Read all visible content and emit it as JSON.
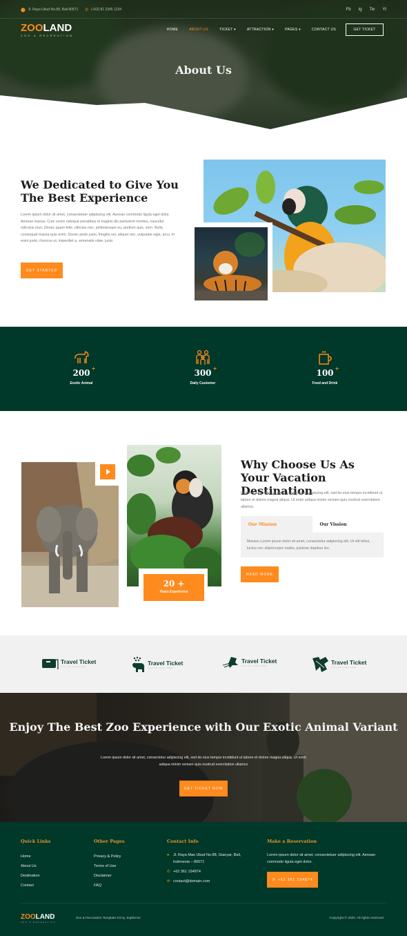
{
  "topbar": {
    "address": "Jl. Raya Ubud No.88, Bali 80571",
    "phone": "(+62) 81 2345 1234",
    "social": [
      "Fb",
      "Ig",
      "Tw",
      "Yt"
    ]
  },
  "brand": {
    "name_part1": "Z",
    "name_o": "OO",
    "name_part2": "LAND",
    "tagline": "ZOO & RECREATION"
  },
  "nav": {
    "items": [
      {
        "label": "HOME",
        "active": false
      },
      {
        "label": "ABOUT US",
        "active": true
      },
      {
        "label": "TICKET",
        "dropdown": true
      },
      {
        "label": "ATTRACTION",
        "dropdown": true
      },
      {
        "label": "PAGES",
        "dropdown": true
      },
      {
        "label": "CONTACT US",
        "active": false
      }
    ],
    "cta": "GET TICKET"
  },
  "hero": {
    "title": "About Us"
  },
  "about": {
    "title": "We Dedicated to Give You The Best Experience",
    "text": "Lorem ipsum dolor sit amet, consectetuer adipiscing elit. Aenean commodo ligula eget dolor. Aenean massa. Cum sociis natoque penatibus et magnis dis parturient montes, nascetur ridiculus mus. Donec quam felis, ultricies nec, pellentesque eu, pretium quis, sem. Nulla consequat massa quis enim. Donec pede justo, fringilla vel, aliquet nec, vulputate eget, arcu. In enim justo, rhoncus ut, imperdiet a, venenatis vitae, justo.",
    "button": "GET STARTED"
  },
  "stats": [
    {
      "icon": "horse-icon",
      "value": "200",
      "suffix": "+",
      "label": "Exotic Animal"
    },
    {
      "icon": "family-icon",
      "value": "300",
      "suffix": "+",
      "label": "Daily Customer"
    },
    {
      "icon": "cup-icon",
      "value": "100",
      "suffix": "+",
      "label": "Food and Drink"
    }
  ],
  "why": {
    "title": "Why Choose Us As Your Vacation Destination",
    "text": "Lorem ipsum dolor sit amet, consectetur adipiscing elit, sed do eius tempor incididunt ut labore et dolore magna aliqua. Ut enim adiqua minim veniam quis nostrud exercitation ullamco.",
    "tabs": [
      "Our Mission",
      "Our Vission"
    ],
    "active_tab": "Our Mission",
    "panel_text": "Mission Lorem ipsum dolor sit amet, consectetur adipiscing elit. Ut elit tellus, luctus nec ullamcorper mattis, pulvinar dapibus leo.",
    "button": "READ MORE",
    "experience_value": "20 +",
    "experience_label": "Years Experience"
  },
  "partners": [
    {
      "name": "Travel Ticket",
      "tagline": "TAGLINE GOES HERE"
    },
    {
      "name": "Travel Ticket",
      "tagline": "TAGLINE GOES HERE"
    },
    {
      "name": "Travel Ticket",
      "tagline": "TAGLINE GOES HERE"
    },
    {
      "name": "Travel Ticket",
      "tagline": "TAGLINE GOES HERE"
    }
  ],
  "cta": {
    "title": "Enjoy The Best Zoo Experience with Our Exotic Animal Variant",
    "text": "Lorem ipsum dolor sit amet, consectetur adipiscing elit, sed do eius tempor incididunt ut labore et dolore magna aliqua. Ut enim adiqua minim veniam quis nostrud exercitation ullamco",
    "button": "GET TICKET NOW"
  },
  "footer": {
    "quick_links": {
      "title": "Quick Links",
      "items": [
        "Home",
        "About Us",
        "Destination",
        "Contact"
      ]
    },
    "other_pages": {
      "title": "Other Pages",
      "items": [
        "Privacy & Policy",
        "Terms of Use",
        "Disclaimer",
        "FAQ"
      ]
    },
    "contact": {
      "title": "Contact Info",
      "address": "Jl. Raya Mas Ubud No.88, Gianyar, Bali, Indonesia – 80571",
      "phone": "+62 361 154874",
      "email": "contact@domain.com"
    },
    "reservation": {
      "title": "Make a Reservation",
      "text": "Lorem ipsum dolor sit amet, consectetuer adipiscing elit. Aenean commodo ligula eget dolor.",
      "button": "+62 361 154874"
    },
    "credit": "Zoo & Recreation Template Kit by Jegtheme",
    "copyright": "Copyright © 2020. All rights reserved."
  },
  "colors": {
    "accent": "#ff8a1d",
    "dark_green": "#00382a",
    "light_gray": "#f1f1f1"
  }
}
